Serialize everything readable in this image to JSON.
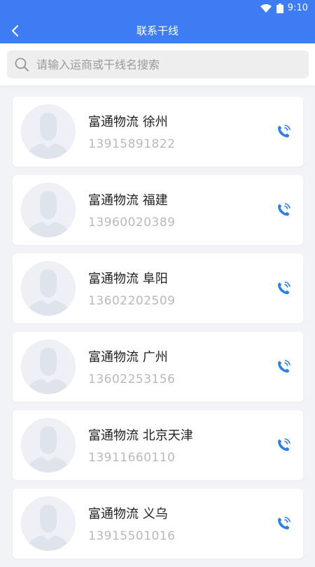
{
  "status": {
    "time": "9:10"
  },
  "header": {
    "title": "联系干线"
  },
  "search": {
    "placeholder": "请输入运商或干线名搜索",
    "value": ""
  },
  "contacts": [
    {
      "name": "富通物流 徐州",
      "phone": "13915891822"
    },
    {
      "name": "富通物流 福建",
      "phone": "13960020389"
    },
    {
      "name": "富通物流 阜阳",
      "phone": "13602202509"
    },
    {
      "name": "富通物流 广州",
      "phone": "13602253156"
    },
    {
      "name": "富通物流 北京天津",
      "phone": "13911660110"
    },
    {
      "name": "富通物流 义乌",
      "phone": "13915501016"
    }
  ],
  "colors": {
    "accent": "#3e7cf3",
    "call_icon": "#2e7fe8"
  }
}
